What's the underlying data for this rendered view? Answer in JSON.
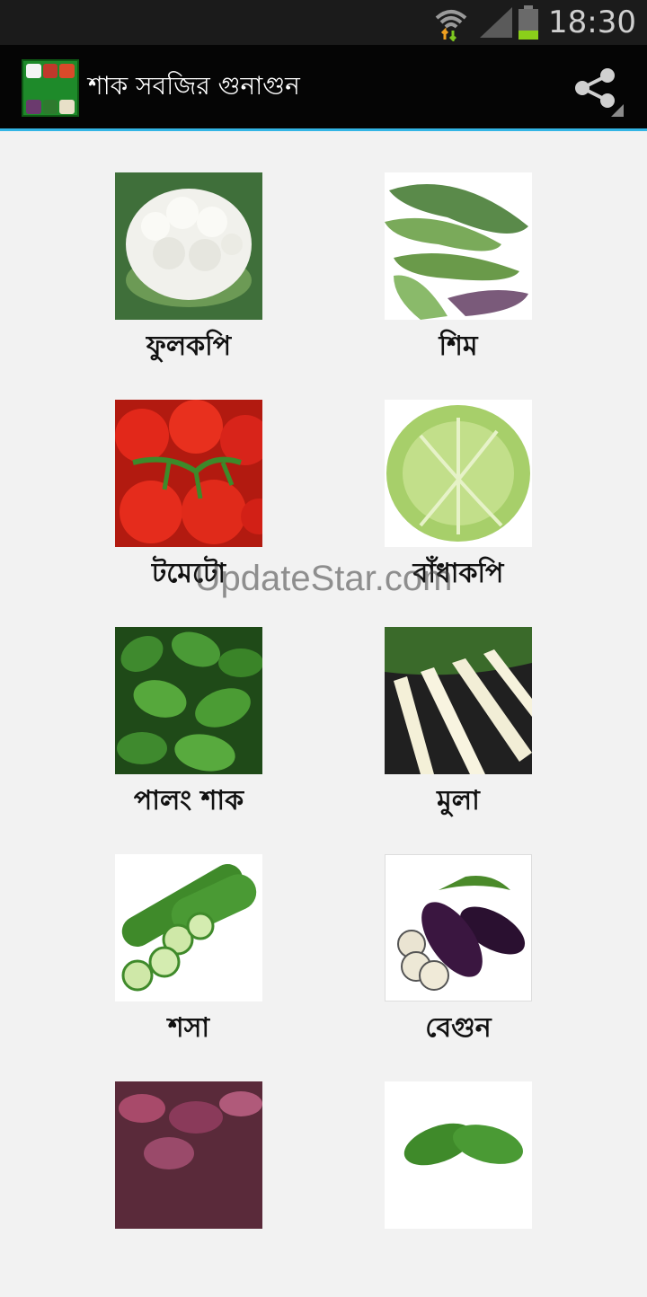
{
  "status_bar": {
    "time": "18:30",
    "wifi_icon": "wifi-icon",
    "signal_icon": "signal-icon",
    "battery_icon": "battery-icon"
  },
  "app_bar": {
    "title": "শাক সবজির  গুনাগুন",
    "share_icon": "share-icon",
    "accent_color": "#33b5e5"
  },
  "vegetables": [
    {
      "label": "ফুলকপি"
    },
    {
      "label": "শিম"
    },
    {
      "label": "টমেটো"
    },
    {
      "label": "বাঁধাকপি"
    },
    {
      "label": "পালং শাক"
    },
    {
      "label": "মুলা"
    },
    {
      "label": "শসা"
    },
    {
      "label": "বেগুন"
    },
    {
      "label": ""
    },
    {
      "label": ""
    }
  ],
  "watermark": "UpdateStar.com"
}
